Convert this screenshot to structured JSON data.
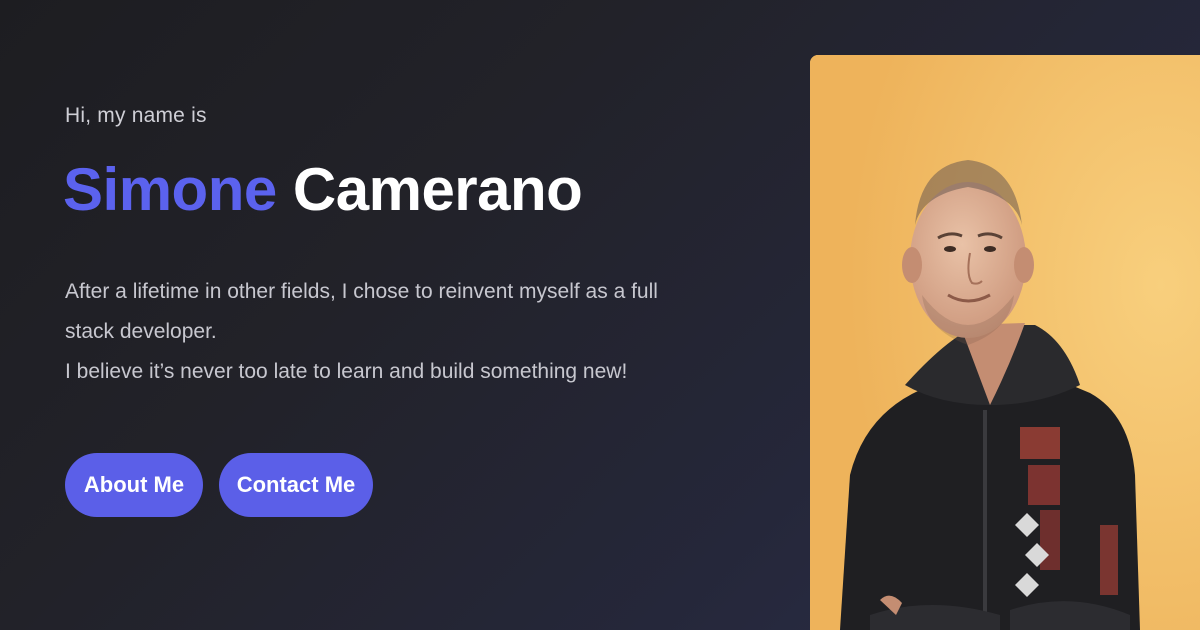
{
  "hero": {
    "intro": "Hi, my name is",
    "first_name": "Simone",
    "last_name": "Camerano",
    "bio_line1": "After a lifetime in other fields, I chose to reinvent myself as a full stack developer.",
    "bio_line2": "I believe it’s never too late to learn and build something new!",
    "buttons": {
      "about": "About Me",
      "contact": "Contact Me"
    }
  },
  "colors": {
    "accent": "#5b5fe8",
    "first_name": "#5b62ee",
    "photo_background": "#f0b75f"
  },
  "icons": {
    "portrait": "profile-photo"
  }
}
